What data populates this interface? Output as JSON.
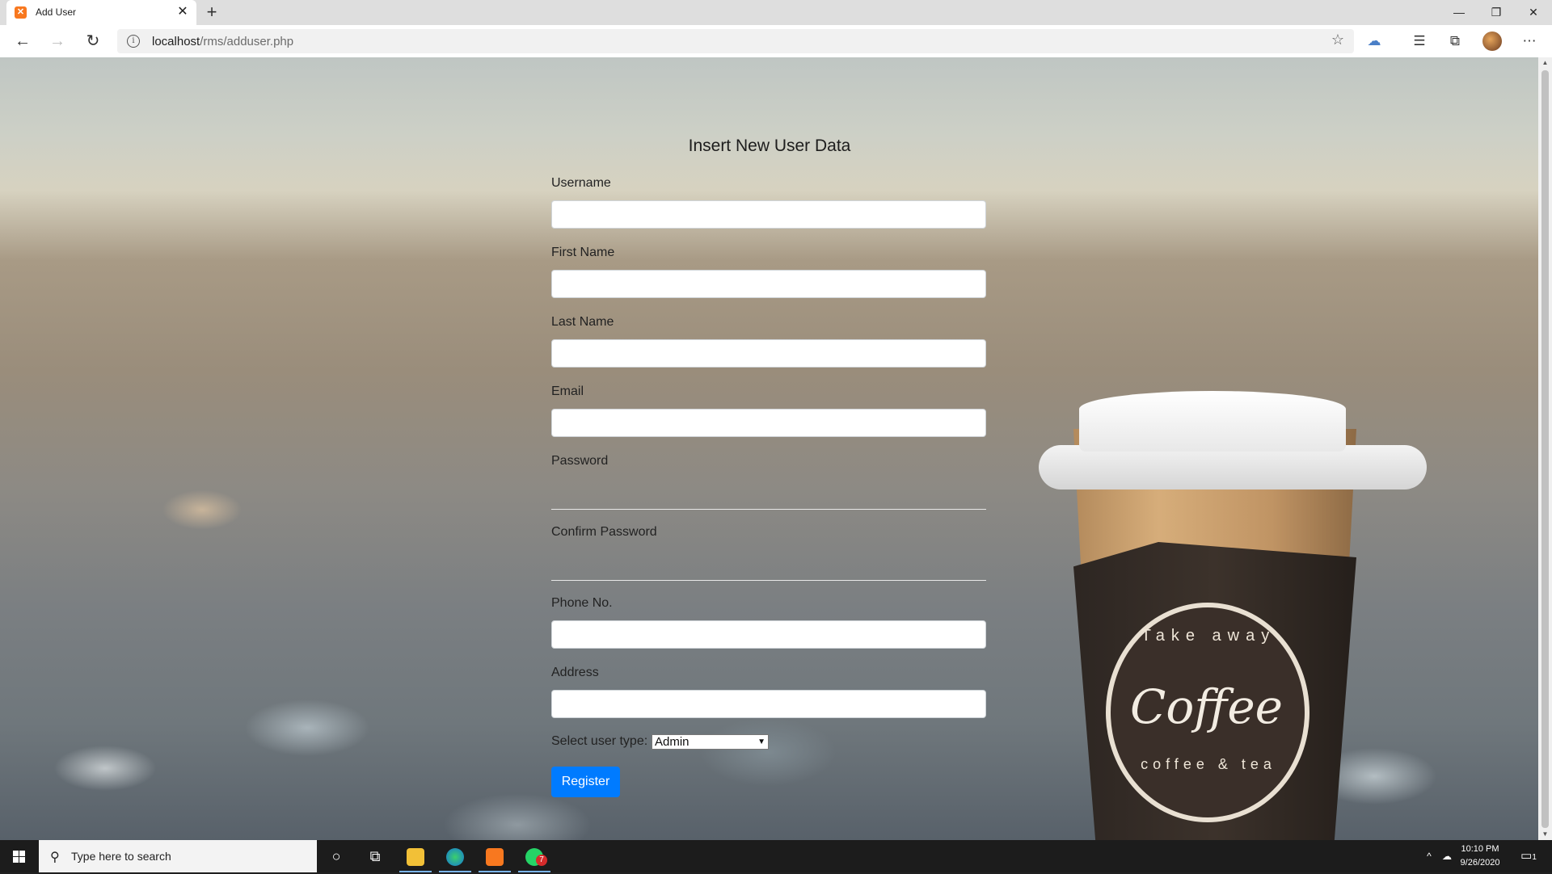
{
  "browser": {
    "tab": {
      "title": "Add User",
      "favicon": "xampp-icon"
    },
    "new_tab_glyph": "+",
    "window": {
      "minimize": "—",
      "restore": "❐",
      "close": "✕"
    },
    "nav": {
      "back": "←",
      "forward": "→",
      "reload": "↻"
    },
    "url": {
      "host": "localhost",
      "path": "/rms/adduser.php"
    },
    "toolbar_icons": [
      "onedrive-icon",
      "favorites-icon",
      "collections-icon",
      "profile-avatar",
      "more-icon"
    ]
  },
  "form": {
    "title": "Insert New User Data",
    "fields": {
      "username": {
        "label": "Username",
        "value": ""
      },
      "first_name": {
        "label": "First Name",
        "value": ""
      },
      "last_name": {
        "label": "Last Name",
        "value": ""
      },
      "email": {
        "label": "Email",
        "value": ""
      },
      "password": {
        "label": "Password",
        "value": ""
      },
      "confirm_password": {
        "label": "Confirm Password",
        "value": ""
      },
      "phone": {
        "label": "Phone No.",
        "value": ""
      },
      "address": {
        "label": "Address",
        "value": ""
      }
    },
    "user_type": {
      "label": "Select user type:",
      "selected": "Admin"
    },
    "submit_label": "Register"
  },
  "background": {
    "cup_logo_top": "Take away",
    "cup_logo_main": "Coffee",
    "cup_logo_bottom": "coffee & tea"
  },
  "taskbar": {
    "search_placeholder": "Type here to search",
    "apps": [
      "cortana-icon",
      "task-view-icon",
      "file-explorer-icon",
      "edge-icon",
      "xampp-icon",
      "whatsapp-icon"
    ],
    "whatsapp_badge": "7",
    "clock_time": "10:10 PM",
    "clock_date": "9/26/2020",
    "notification_count": "1"
  },
  "colors": {
    "accent": "#007bff",
    "taskbar": "#1c1c1c"
  }
}
